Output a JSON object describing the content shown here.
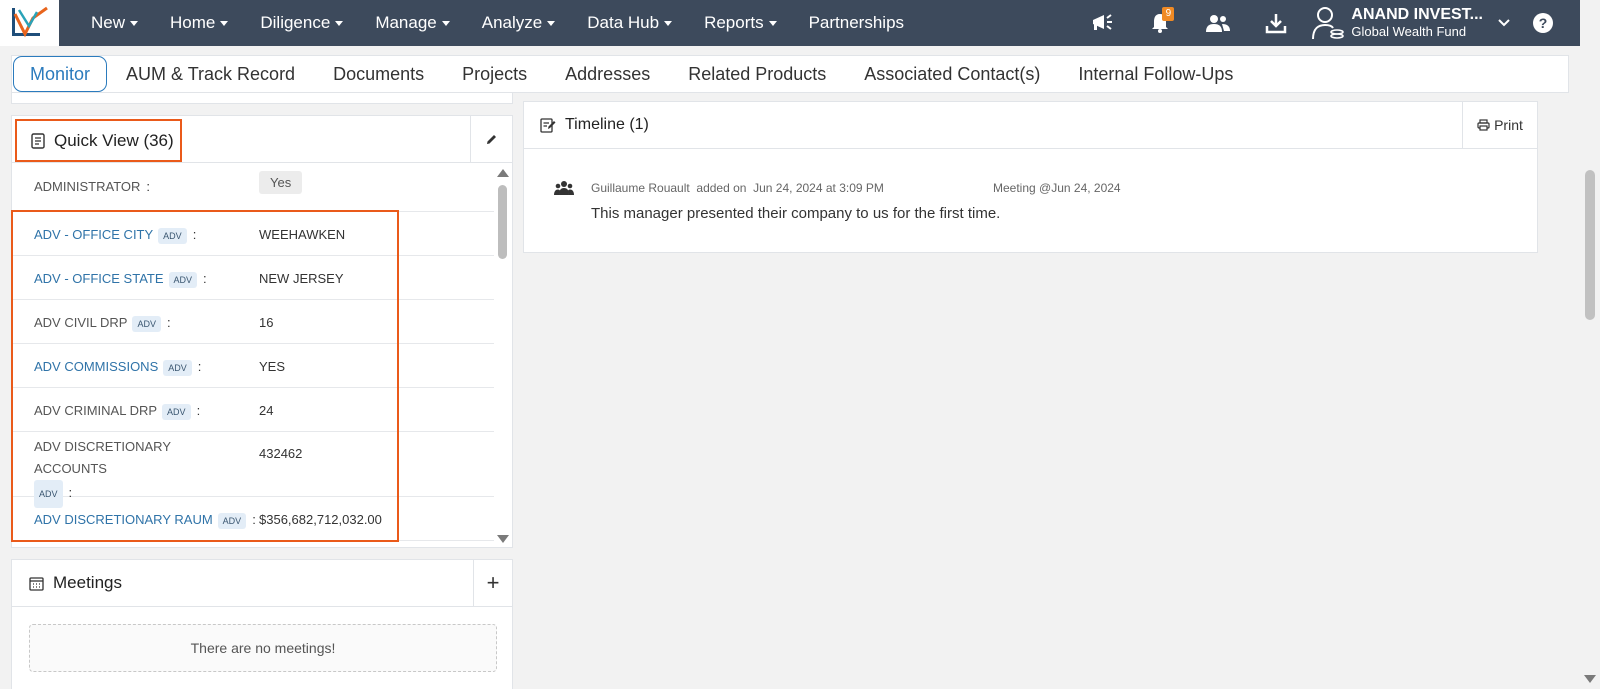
{
  "nav": {
    "menu": [
      {
        "label": "New",
        "has_caret": true
      },
      {
        "label": "Home",
        "has_caret": true
      },
      {
        "label": "Diligence",
        "has_caret": true
      },
      {
        "label": "Manage",
        "has_caret": true
      },
      {
        "label": "Analyze",
        "has_caret": true
      },
      {
        "label": "Data Hub",
        "has_caret": true
      },
      {
        "label": "Reports",
        "has_caret": true
      },
      {
        "label": "Partnerships",
        "has_caret": false
      }
    ],
    "notification_count": "9",
    "account_name": "ANAND INVEST...",
    "account_sub": "Global Wealth Fund",
    "help_label": "?",
    "icons": [
      "announcement-icon",
      "bell-icon",
      "users-icon",
      "download-icon",
      "account-icon",
      "chevron-down-icon",
      "help-icon"
    ]
  },
  "tabs": [
    {
      "label": "Monitor",
      "active": true
    },
    {
      "label": "AUM & Track Record"
    },
    {
      "label": "Documents"
    },
    {
      "label": "Projects"
    },
    {
      "label": "Addresses"
    },
    {
      "label": "Related Products"
    },
    {
      "label": "Associated Contact(s)"
    },
    {
      "label": "Internal Follow-Ups"
    }
  ],
  "quick_view": {
    "title": "Quick View (36)",
    "rows": [
      {
        "label": "ADMINISTRATOR",
        "adv": false,
        "link": false,
        "value": "Yes",
        "pill": true
      },
      {
        "label": "ADV - OFFICE CITY",
        "adv": true,
        "link": true,
        "value": "WEEHAWKEN"
      },
      {
        "label": "ADV - OFFICE STATE",
        "adv": true,
        "link": true,
        "value": "NEW JERSEY"
      },
      {
        "label": "ADV CIVIL DRP",
        "adv": true,
        "link": false,
        "value": "16"
      },
      {
        "label": "ADV COMMISSIONS",
        "adv": true,
        "link": true,
        "value": "YES"
      },
      {
        "label": "ADV CRIMINAL DRP",
        "adv": true,
        "link": false,
        "value": "24"
      },
      {
        "label": "ADV DISCRETIONARY ACCOUNTS",
        "adv": true,
        "link": false,
        "value": "432462"
      },
      {
        "label": "ADV DISCRETIONARY RAUM",
        "adv": true,
        "link": true,
        "value": "$356,682,712,032.00"
      }
    ],
    "adv_tag": "ADV",
    "colon": ":"
  },
  "meetings": {
    "title": "Meetings",
    "add_label": "+",
    "empty_text": "There are no meetings!"
  },
  "timeline": {
    "title": "Timeline (1)",
    "print_label": "Print",
    "entry": {
      "author": "Guillaume Rouault",
      "action": "added on",
      "date": "Jun 24, 2024 at 3:09 PM",
      "meeting": "Meeting @Jun 24, 2024",
      "text": "This manager presented their company to us for the first time."
    }
  },
  "colors": {
    "navbar": "#3d4a5c",
    "accent": "#2b7bbd",
    "highlight": "#ea5a1a",
    "badge": "#f08a24"
  }
}
